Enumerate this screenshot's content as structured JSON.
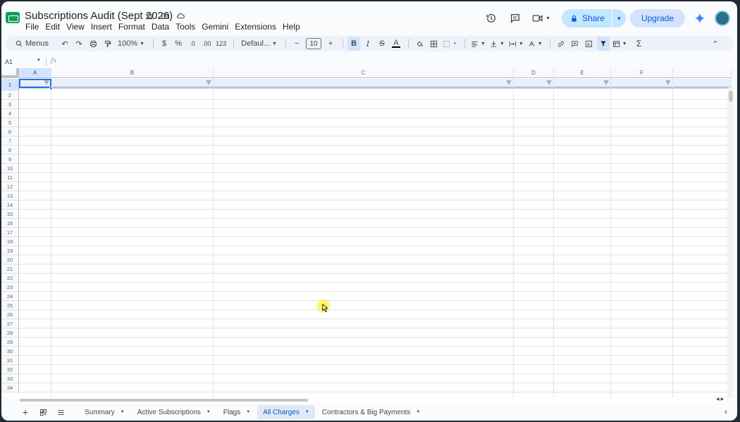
{
  "app": {
    "doc_title": "Subscriptions Audit (Sept 2026)",
    "menus": [
      "File",
      "Edit",
      "View",
      "Insert",
      "Format",
      "Data",
      "Tools",
      "Gemini",
      "Extensions",
      "Help"
    ],
    "share_label": "Share",
    "upgrade_label": "Upgrade"
  },
  "toolbar": {
    "menus_label": "Menus",
    "zoom": "100%",
    "currency": "$",
    "percent": "%",
    "dec_decrease": ".0",
    "dec_increase": ".00",
    "number_format": "123",
    "font_family": "Defaul...",
    "font_size": "10",
    "bold": "B",
    "italic": "I",
    "strike": "S",
    "text_color": "A",
    "sum": "Σ"
  },
  "formula_bar": {
    "name_box": "A1",
    "fx": "fx",
    "value": ""
  },
  "grid": {
    "columns": [
      "A",
      "B",
      "C",
      "D",
      "E",
      "F"
    ],
    "rows": [
      "1",
      "2",
      "3",
      "4",
      "5",
      "6",
      "7",
      "8",
      "9",
      "10",
      "11",
      "12",
      "13",
      "14",
      "15",
      "16",
      "17",
      "18",
      "19",
      "20",
      "21",
      "22",
      "23",
      "24",
      "25",
      "26",
      "27",
      "28",
      "29",
      "30",
      "31",
      "32",
      "33",
      "34"
    ],
    "selected_cell": "A1"
  },
  "sheets": {
    "tabs": [
      "Summary",
      "Active Subscriptions",
      "Flags",
      "All Charges",
      "Contractors & Big Payments"
    ],
    "active_tab": "All Charges"
  },
  "colors": {
    "accent": "#0b57d0",
    "selection": "#1a73e8",
    "share_bg": "#c2e7ff",
    "upgrade_bg": "#d3e3fd",
    "toolbar_bg": "#edf2fa"
  }
}
